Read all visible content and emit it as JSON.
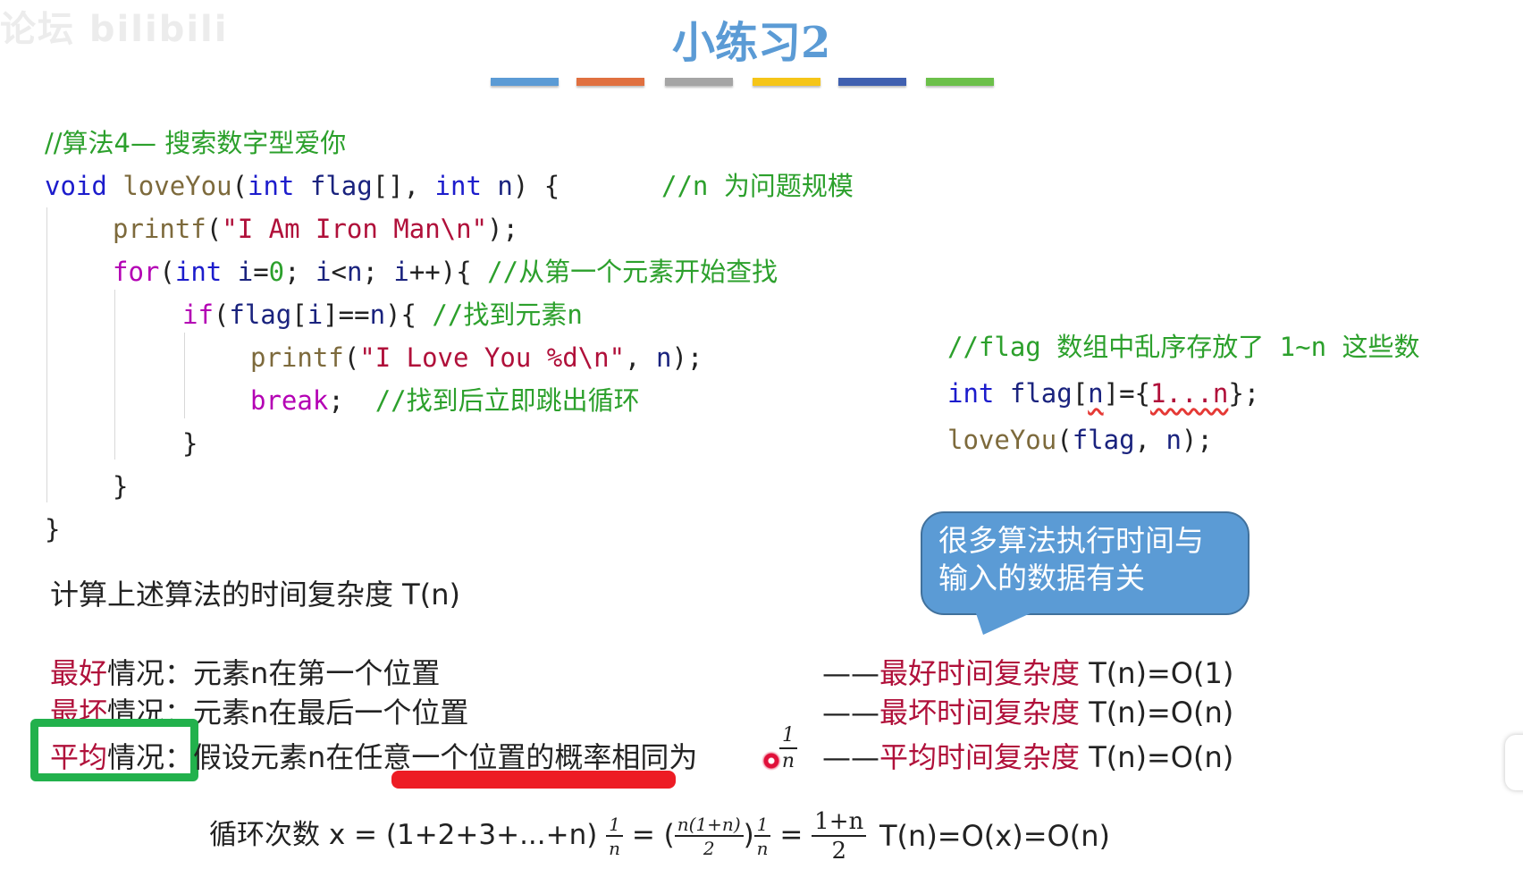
{
  "watermark": "论坛 bilibili",
  "slide": {
    "title": "小练习2",
    "title_color": "#5b9bd5",
    "bar_colors": [
      "#5b9bd5",
      "#e07040",
      "#a5a5a5",
      "#f5c518",
      "#4060b0",
      "#6cc04a"
    ]
  },
  "code": {
    "comment_header": "//算法4— 搜索数字型爱你",
    "line1": {
      "kw1": "void",
      "fn": "loveYou",
      "p1": "(",
      "kw2": "int",
      "v1": "flag",
      "p2": "[], ",
      "kw3": "int",
      "v2": "n",
      "p3": ") {",
      "comment": "//n 为问题规模"
    },
    "line2": {
      "fn": "printf",
      "p1": "(",
      "str": "\"I Am Iron Man\\n\"",
      "p2": ");"
    },
    "line3": {
      "ctl": "for",
      "p1": "(",
      "kw": "int",
      "v1": "i",
      "p2": "=",
      "num": "0",
      "p3": "; ",
      "v2": "i",
      "p4": "<",
      "v3": "n",
      "p5": "; ",
      "v4": "i",
      "p6": "++){ ",
      "comment": "//从第一个元素开始查找"
    },
    "line4": {
      "ctl": "if",
      "p1": "(",
      "v1": "flag",
      "p2": "[",
      "v2": "i",
      "p3": "]==",
      "v3": "n",
      "p4": "){ ",
      "comment": "//找到元素n"
    },
    "line5": {
      "fn": "printf",
      "p1": "(",
      "str": "\"I Love You %d\\n\"",
      "p2": ", ",
      "v": "n",
      "p3": ");"
    },
    "line6": {
      "ctl": "break",
      "p1": ";",
      "comment": "//找到后立即跳出循环"
    },
    "close_brace": "}"
  },
  "side_code": {
    "comment": "//flag 数组中乱序存放了 1~n 这些数",
    "decl": {
      "kw": "int",
      "v": "flag",
      "p1": "[",
      "n": "n",
      "p2": "]={",
      "range": "1...n",
      "p3": "};"
    },
    "call": {
      "fn": "loveYou",
      "p1": "(",
      "v1": "flag",
      "p2": ", ",
      "v2": "n",
      "p3": ");"
    }
  },
  "bubble": {
    "line1": "很多算法执行时间与",
    "line2": "输入的数据有关"
  },
  "analysis": {
    "question": "计算上述算法的时间复杂度 T(n)",
    "best": {
      "label_red": "最好",
      "label_rest": "情况：",
      "desc": "元素n在第一个位置",
      "dash": "——",
      "result_red": "最好时间复杂度",
      "result": " T(n)=O(1)"
    },
    "worst": {
      "label_red": "最坏",
      "label_rest": "情况：",
      "desc": "元素n在最后一个位置",
      "dash": "——",
      "result_red": "最坏时间复杂度",
      "result": " T(n)=O(n)"
    },
    "average": {
      "label_red": "平均",
      "label_rest": "情况：",
      "desc": "假设元素n在任意一个位置的概率相同为",
      "frac_num": "1",
      "frac_den": "n",
      "dash": "——",
      "result_red": "平均时间复杂度",
      "result": " T(n)=O(n)"
    },
    "loop": {
      "label": "循环次数 x = (1+2+3+...+n)",
      "f1_num": "1",
      "f1_den": "n",
      "eq1": "=",
      "paren_open": "(",
      "f2_num": "n(1+n)",
      "f2_den": "2",
      "paren_close": ")",
      "f3_num": "1",
      "f3_den": "n",
      "eq2": "=",
      "f4_num": "1+n",
      "f4_den": "2",
      "result": "T(n)=O(x)=O(n)"
    }
  }
}
